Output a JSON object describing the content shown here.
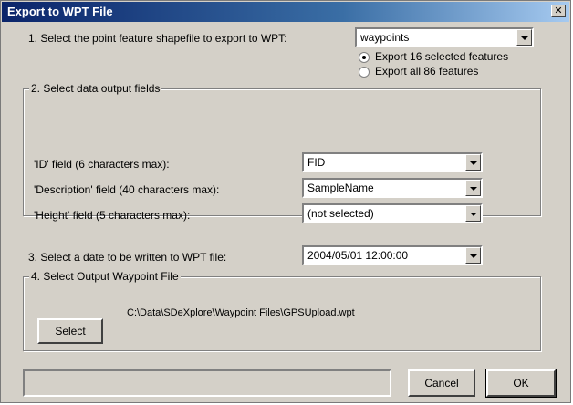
{
  "window": {
    "title": "Export to WPT File"
  },
  "step1": {
    "label": "1. Select the point feature shapefile to export to WPT:",
    "shapefile_value": "waypoints",
    "radio_selected_label": "Export 16 selected features",
    "radio_all_label": "Export all 86 features",
    "selected_option": "selected"
  },
  "step2": {
    "group_title": "2. Select data output fields",
    "id_label": "'ID' field (6 characters max):",
    "id_value": "FID",
    "desc_label": "'Description' field (40 characters max):",
    "desc_value": "SampleName",
    "height_label": "'Height' field (5 characters max):",
    "height_value": "(not selected)"
  },
  "step3": {
    "label": "3. Select a date to be written to WPT file:",
    "date_value": "2004/05/01 12:00:00"
  },
  "step4": {
    "group_title": "4. Select Output Waypoint File",
    "select_button": "Select",
    "path": "C:\\Data\\SDeXplore\\Waypoint Files\\GPSUpload.wpt"
  },
  "footer": {
    "status_text": "",
    "cancel_button": "Cancel",
    "ok_button": "OK"
  }
}
